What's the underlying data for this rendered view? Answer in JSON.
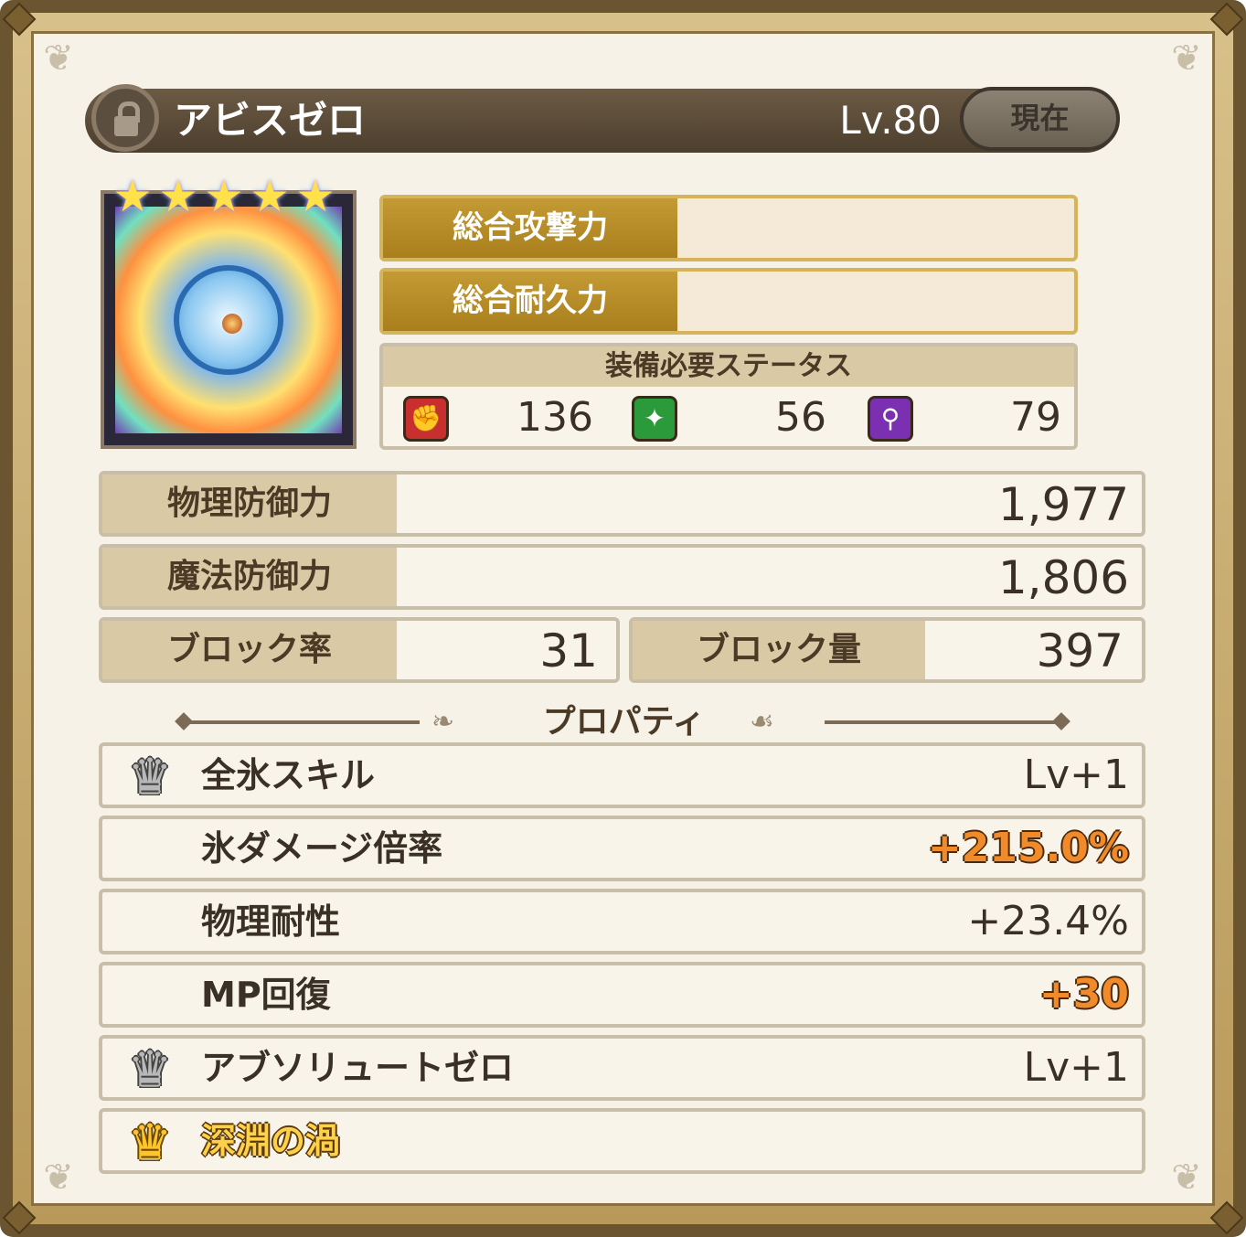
{
  "header": {
    "item_name": "アビスゼロ",
    "level": "Lv.80",
    "current_button": "現在"
  },
  "item": {
    "stars": 5
  },
  "totals": {
    "attack_label": "総合攻撃力",
    "durability_label": "総合耐久力"
  },
  "requirements": {
    "title": "装備必要ステータス",
    "items": [
      {
        "icon": "fist-icon",
        "color": "#c83030",
        "value": "136"
      },
      {
        "icon": "sparkle-icon",
        "color": "#2a9a3a",
        "value": "56"
      },
      {
        "icon": "wand-icon",
        "color": "#7a30b0",
        "value": "79"
      }
    ]
  },
  "stats": {
    "physical_defense": {
      "label": "物理防御力",
      "value": "1,977"
    },
    "magic_defense": {
      "label": "魔法防御力",
      "value": "1,806"
    },
    "block_rate": {
      "label": "ブロック率",
      "value": "31"
    },
    "block_amount": {
      "label": "ブロック量",
      "value": "397"
    }
  },
  "properties": {
    "title": "プロパティ",
    "items": [
      {
        "name": "全氷スキル",
        "value": "Lv+1",
        "crown": "silver"
      },
      {
        "name": "氷ダメージ倍率",
        "value": "+215.0%",
        "highlight": true
      },
      {
        "name": "物理耐性",
        "value": "+23.4%"
      },
      {
        "name": "MP回復",
        "value": "+30",
        "highlight": true
      },
      {
        "name": "アブソリュートゼロ",
        "value": "Lv+1",
        "crown": "silver"
      },
      {
        "name": "深淵の渦",
        "value": "",
        "crown": "gold"
      }
    ]
  }
}
